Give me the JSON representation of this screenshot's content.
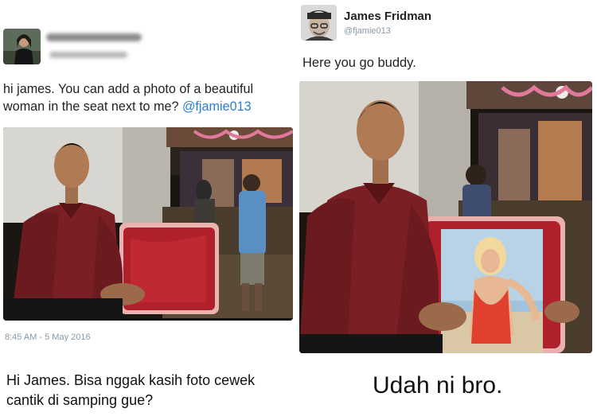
{
  "left_tweet": {
    "text_before": "hi james. You can add a photo of a beautiful woman in the seat next to me? ",
    "mention": "@fjamie013",
    "timestamp": "8:45 AM - 5 May 2016",
    "avatar_icon": "user-avatar-photo"
  },
  "right_tweet": {
    "name": "James Fridman",
    "handle": "@fjamie013",
    "text": "Here you go buddy.",
    "avatar_icon": "user-avatar-photo"
  },
  "captions": {
    "left": "Hi James. Bisa nggak kasih foto cewek cantik di samping gue?",
    "right": "Udah ni bro."
  },
  "colors": {
    "mention": "#2a7fd4",
    "meta": "#8899a6",
    "shirt": "#7a1f24",
    "chair": "#b0202a"
  }
}
